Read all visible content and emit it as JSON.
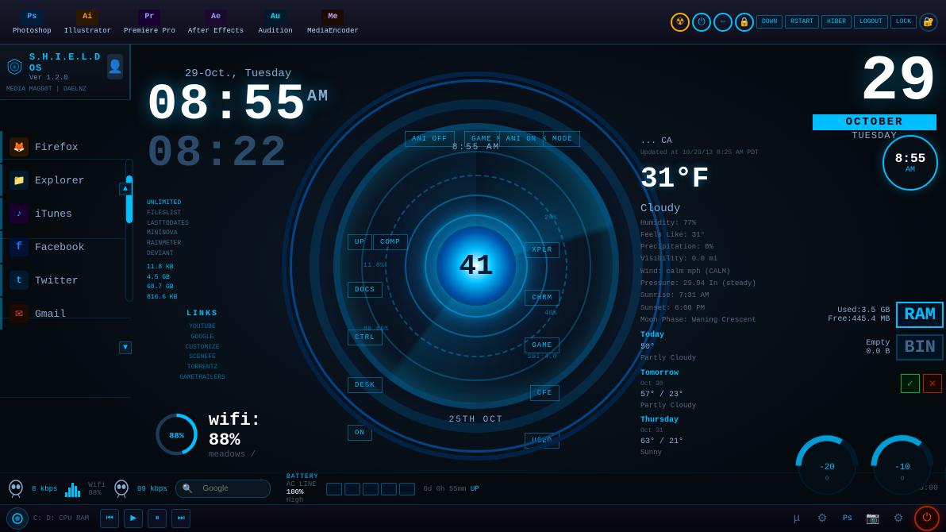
{
  "os": {
    "name": "S.H.I.E.L.D OS",
    "version": "Ver 1.2.0",
    "user": "MEDIA MAGG0T | DAELNZ"
  },
  "topbar": {
    "apps": [
      {
        "label": "Photoshop",
        "abbr": "Ps",
        "class": "ps-icon"
      },
      {
        "label": "Illustrator",
        "abbr": "Ai",
        "class": "ai-icon"
      },
      {
        "label": "Premiere Pro",
        "abbr": "Pr",
        "class": "pr-icon"
      },
      {
        "label": "After Effects",
        "abbr": "Ae",
        "class": "ae-icon"
      },
      {
        "label": "Audition",
        "abbr": "Au",
        "class": "au-icon"
      },
      {
        "label": "MediaEncoder",
        "abbr": "Me",
        "class": "me-icon"
      }
    ],
    "controls": [
      "DOWN",
      "RSTART",
      "HIBER",
      "LOGOUT",
      "LOCK"
    ]
  },
  "datetime": {
    "date": "29-Oct., Tuesday",
    "time": "08:55",
    "ampm": "AM",
    "time2": "08:22",
    "big_date": "29",
    "month": "OCTOBER",
    "day": "TUESDAY"
  },
  "nav": {
    "items": [
      {
        "label": "Firefox",
        "icon": "🦊",
        "color": "#ff6600"
      },
      {
        "label": "Explorer",
        "icon": "📁",
        "color": "#00bfff"
      },
      {
        "label": "iTunes",
        "icon": "♪",
        "color": "#cc44ff"
      },
      {
        "label": "Facebook",
        "icon": "f",
        "color": "#1877f2"
      },
      {
        "label": "Twitter",
        "icon": "t",
        "color": "#1da1f2"
      },
      {
        "label": "Gmail",
        "icon": "✉",
        "color": "#dd4b39"
      }
    ]
  },
  "arc": {
    "center_number": "41",
    "time_display": "8:55 AM",
    "date_display": "25TH OCT",
    "mode_buttons": [
      "ANI OFF",
      "GAME MODE",
      "DESK MODE",
      "ANI ON"
    ],
    "left_btns": [
      "UP",
      "COMP",
      "DOCS",
      "CTRL",
      "DESK",
      "ON"
    ],
    "right_btns": [
      "XPLR",
      "CHRM",
      "GAME",
      "CFE",
      "USED"
    ]
  },
  "left_info": {
    "items": [
      {
        "label": "UNLIMITED",
        "value": "FILESLIST"
      },
      {
        "label": "LASTTODATES",
        "value": ""
      },
      {
        "label": "MININOVA",
        "value": ""
      },
      {
        "label": "RAINMETER",
        "value": ""
      },
      {
        "label": "DEVIANT",
        "value": ""
      }
    ],
    "stats": [
      {
        "label": "11.8 KB"
      },
      {
        "label": "4.5 GB"
      },
      {
        "label": "68.7 GB"
      },
      {
        "label": "816.6 KB"
      }
    ],
    "links": [
      "YOUTUBE",
      "GOOGLE",
      "CUSTOMIZE",
      "SCENEFE",
      "TORRENTZ",
      "GAMETRAILERS"
    ]
  },
  "weather": {
    "location": "... CA",
    "updated": "Updated at 10/29/13 8:25 AM PDT",
    "temp": "31°F",
    "condition": "Cloudy",
    "humidity": "Humidity: 77%",
    "feels_like": "Feels Like: 31°",
    "precipitation": "Precipitation: 0%",
    "visibility": "Visibility: 0.0 mi",
    "wind": "Wind: calm mph (CALM)",
    "pressure": "Pressure: 29.94 In (steady)",
    "sunrise": "Sunrise: 7:31 AM",
    "sunset": "Sunset: 6:00 PM",
    "moon": "Moon Phase: Waning Crescent",
    "forecast": [
      {
        "day": "Today",
        "temp": "50°",
        "condition": "Partly Cloudy"
      },
      {
        "day": "Tomorrow",
        "date": "Oct 30",
        "temp": "57° / 23°",
        "condition": "Partly Cloudy"
      },
      {
        "day": "Thursday",
        "date": "Oct 31",
        "temp": "63° / 21°",
        "condition": "Sunny"
      }
    ]
  },
  "system": {
    "ram_used": "Used:3.5 GB",
    "ram_free": "Free:445.4 MB",
    "ram_label": "RAM",
    "bin_status": "Empty",
    "bin_size": "0.0 B",
    "bin_label": "BIN"
  },
  "wifi": {
    "label": "wifi: 88%",
    "network": "meadows /",
    "percent": 88
  },
  "bottom": {
    "battery": "BATTERY",
    "ac_line": "AC LINE",
    "battery_pct": "100%",
    "battery_level": "High",
    "uptime": "0d 0h 55mm",
    "uptime_label": "UP",
    "search_placeholder": "Google",
    "time_display": "0:00",
    "drives": "C: D: CPU RAM"
  },
  "network_mini": {
    "left_kbps": "8 kbps",
    "wifi_label": "Wifi",
    "wifi_pct": "88%",
    "right_kbps": "09 kbps"
  }
}
